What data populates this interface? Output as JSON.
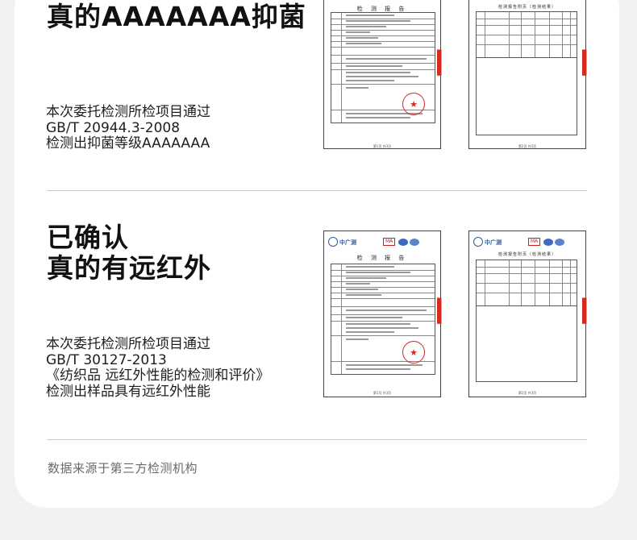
{
  "section1": {
    "title_line": "真的AAAAAAA抑菌",
    "desc": [
      "本次委托检测所检项目通过",
      "GB/T 20944.3-2008",
      "检测出抑菌等级AAAAAAA"
    ]
  },
  "section2": {
    "title_lines": [
      "已确认",
      "真的有远红外"
    ],
    "desc": [
      "本次委托检测所检项目通过",
      "GB/T 30127-2013",
      "《纺织品 远红外性能的检测和评价》",
      "检测出样品具有远红外性能"
    ]
  },
  "footer": {
    "source": "数据来源于第三方检测机构"
  },
  "docs": {
    "logo_text": "中广测",
    "ma_text": "MA",
    "report_title": "检 测 报 告",
    "results_title": "检测报告附页（检测结果）",
    "stamp_icon": "red-star-seal",
    "stamp_color": "#d42a20"
  }
}
